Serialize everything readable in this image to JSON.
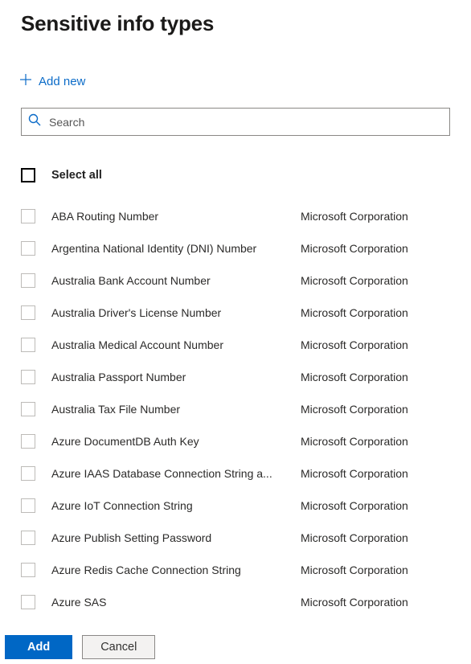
{
  "title": "Sensitive info types",
  "addNew": {
    "label": "Add new"
  },
  "search": {
    "placeholder": "Search"
  },
  "selectAll": {
    "label": "Select all"
  },
  "items": [
    {
      "name": "ABA Routing Number",
      "publisher": "Microsoft Corporation"
    },
    {
      "name": "Argentina National Identity (DNI) Number",
      "publisher": "Microsoft Corporation"
    },
    {
      "name": "Australia Bank Account Number",
      "publisher": "Microsoft Corporation"
    },
    {
      "name": "Australia Driver's License Number",
      "publisher": "Microsoft Corporation"
    },
    {
      "name": "Australia Medical Account Number",
      "publisher": "Microsoft Corporation"
    },
    {
      "name": "Australia Passport Number",
      "publisher": "Microsoft Corporation"
    },
    {
      "name": "Australia Tax File Number",
      "publisher": "Microsoft Corporation"
    },
    {
      "name": "Azure DocumentDB Auth Key",
      "publisher": "Microsoft Corporation"
    },
    {
      "name": "Azure IAAS Database Connection String a...",
      "publisher": "Microsoft Corporation"
    },
    {
      "name": "Azure IoT Connection String",
      "publisher": "Microsoft Corporation"
    },
    {
      "name": "Azure Publish Setting Password",
      "publisher": "Microsoft Corporation"
    },
    {
      "name": "Azure Redis Cache Connection String",
      "publisher": "Microsoft Corporation"
    },
    {
      "name": "Azure SAS",
      "publisher": "Microsoft Corporation"
    }
  ],
  "footer": {
    "add": "Add",
    "cancel": "Cancel"
  },
  "colors": {
    "accent": "#0067c5",
    "link": "#0b6bc8"
  }
}
